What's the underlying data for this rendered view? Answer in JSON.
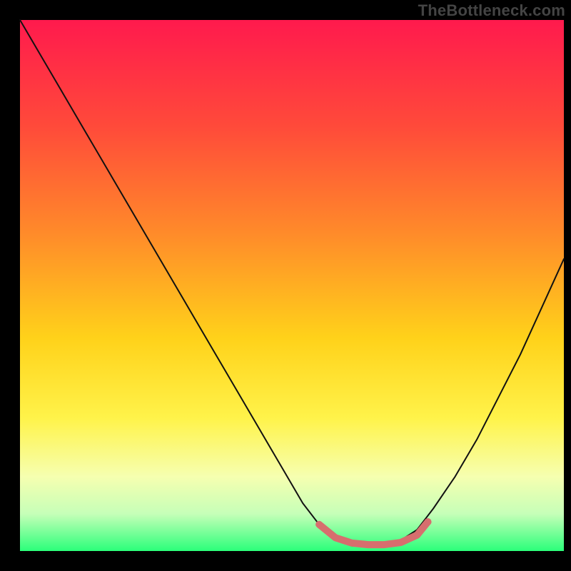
{
  "watermark": "TheBottleneck.com",
  "chart_data": {
    "type": "line",
    "title": "",
    "xlabel": "",
    "ylabel": "",
    "xlim": [
      0,
      100
    ],
    "ylim": [
      0,
      100
    ],
    "grid": false,
    "legend": false,
    "gradient_stops": [
      {
        "offset": 0.0,
        "color": "#ff1a4d"
      },
      {
        "offset": 0.2,
        "color": "#ff4a3a"
      },
      {
        "offset": 0.4,
        "color": "#ff8a2a"
      },
      {
        "offset": 0.6,
        "color": "#ffd21a"
      },
      {
        "offset": 0.75,
        "color": "#fff34a"
      },
      {
        "offset": 0.86,
        "color": "#f6ffb0"
      },
      {
        "offset": 0.93,
        "color": "#c6ffb8"
      },
      {
        "offset": 1.0,
        "color": "#2bff7a"
      }
    ],
    "series": [
      {
        "name": "bottleneck-curve",
        "stroke": "#111111",
        "stroke_width": 2,
        "x": [
          0,
          4,
          8,
          12,
          16,
          20,
          24,
          28,
          32,
          36,
          40,
          44,
          48,
          52,
          55,
          58,
          61,
          64,
          67,
          70,
          73,
          76,
          80,
          84,
          88,
          92,
          96,
          100
        ],
        "y": [
          100,
          93,
          86,
          79,
          72,
          65,
          58,
          51,
          44,
          37,
          30,
          23,
          16,
          9,
          5,
          2,
          1,
          1,
          1,
          2,
          4,
          8,
          14,
          21,
          29,
          37,
          46,
          55
        ]
      },
      {
        "name": "optimal-zone-highlight",
        "stroke": "#d76e6e",
        "stroke_width": 10,
        "x": [
          55,
          58,
          61,
          64,
          67,
          70,
          73,
          75
        ],
        "y": [
          5,
          2.5,
          1.5,
          1.2,
          1.2,
          1.6,
          3,
          5.5
        ]
      }
    ],
    "markers": [
      {
        "name": "optimal-dot",
        "x": 75,
        "y": 5.5,
        "r": 5,
        "fill": "#d76e6e"
      }
    ]
  }
}
